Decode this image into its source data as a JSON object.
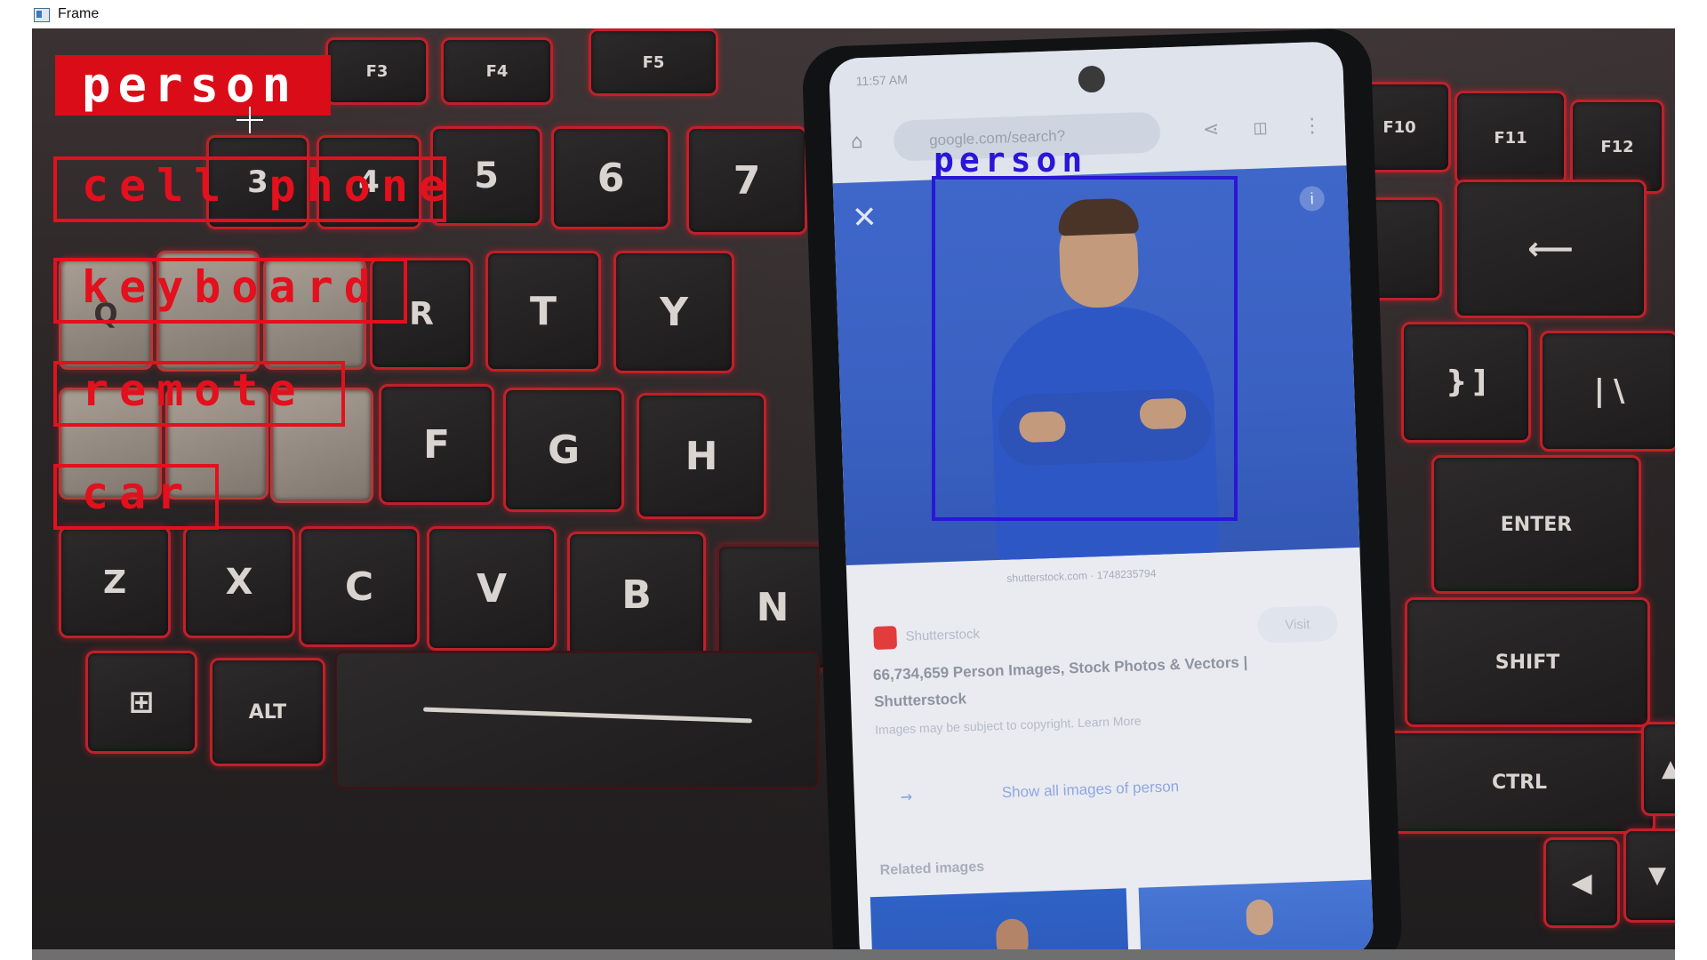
{
  "window": {
    "title": "Frame"
  },
  "detections": {
    "top_label": "person",
    "boxes": [
      {
        "key": "cell_phone",
        "label": "cell phone"
      },
      {
        "key": "keyboard",
        "label": "keyboard"
      },
      {
        "key": "remote",
        "label": "remote"
      },
      {
        "key": "car",
        "label": "car"
      }
    ],
    "phone_box_label": "person",
    "colors": {
      "red": "#e3101d",
      "blue": "#2a16d6"
    }
  },
  "keyboard_keys": {
    "f3": "F3",
    "f4": "F4",
    "f5": "F5",
    "f10": "F10",
    "f11": "F11",
    "f12": "F12",
    "pct": "%",
    "five": "5",
    "six": "6",
    "seven": "7",
    "four": "4",
    "three": "3",
    "caret": "^",
    "amp": "&",
    "hash": "#",
    "dollar": "$",
    "q": "Q",
    "r": "R",
    "t": "T",
    "y": "Y",
    "f": "F",
    "g": "G",
    "h": "H",
    "z": "Z",
    "x": "X",
    "c": "C",
    "v": "V",
    "b": "B",
    "n": "N",
    "alt": "ALT",
    "enter": "ENTER",
    "shift": "SHIFT",
    "ctrl": "CTRL",
    "rbrace": "}",
    "rbracket": "]",
    "pipe": "|",
    "backslash": "\\"
  },
  "phone": {
    "status_time": "11:57 AM",
    "url": "google.com/search?",
    "close_glyph": "✕",
    "info_glyph": "i",
    "source_line": "shutterstock.com · 1748235794",
    "result_source": "Shutterstock",
    "visit_label": "Visit",
    "result_title": "66,734,659 Person Images, Stock Photos & Vectors | Shutterstock",
    "copyright_note": "Images may be subject to copyright. Learn More",
    "show_all": "Show all images of person",
    "related_heading": "Related images"
  }
}
